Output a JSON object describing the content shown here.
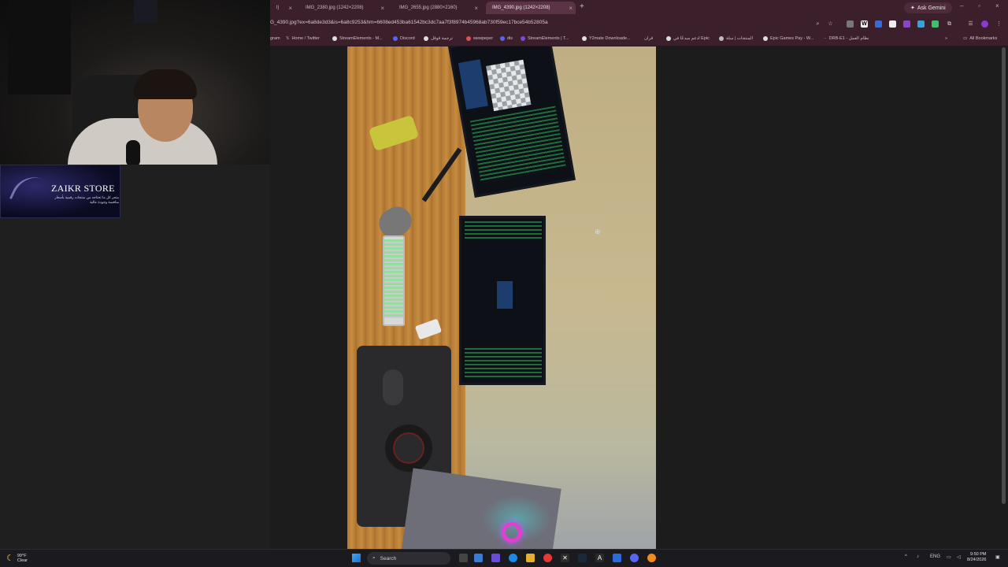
{
  "browser": {
    "tabs": [
      {
        "label": "IMG_2380.jpg (1242×2208)",
        "active": false
      },
      {
        "label": "IMG_2655.jpg (2880×2160)",
        "active": false
      },
      {
        "label": "IMG_4390.jpg (1242×2208)",
        "active": true
      }
    ],
    "partial_tab": "l)",
    "new_tab": "+",
    "gemini_label": "Ask Gemini",
    "url": "G_4390.jpg?ex=6a8de3d3&is=6a8c9253&hm=6608ed453ba61542bc3dc7aa7f3f8974b45968ab730f59ec17bce54b52805a",
    "bookmarks": [
      {
        "label": "gram"
      },
      {
        "label": "Home / Twitter"
      },
      {
        "label": "StreamElements - M..."
      },
      {
        "label": "Discord"
      },
      {
        "label": "ترجمة قوقل"
      },
      {
        "label": "wewpeper"
      },
      {
        "label": "dis"
      },
      {
        "label": "StreamElements | T..."
      },
      {
        "label": "Y2mate Downloade..."
      },
      {
        "label": "قران"
      },
      {
        "label": "ادعم مبدعًا في Epic"
      },
      {
        "label": "المنتجات | سلة"
      },
      {
        "label": "Epic Games Pay - W..."
      },
      {
        "label": "DRB-E1 - نظام العمل"
      }
    ],
    "all_bookmarks": "All Bookmarks",
    "overflow": "»"
  },
  "overlay": {
    "store_title": "ZAIKR STORE",
    "store_sub": "متجر كل ما تحتاجه من منتجات رقمية بأسعار منافسة وجودة عالية"
  },
  "taskbar": {
    "weather_temp": "99°F",
    "weather_desc": "Clear",
    "search_placeholder": "Search",
    "lang": "ENG",
    "time": "9:50 PM",
    "date": "8/24/2026"
  },
  "colors": {
    "chrome": "#3b1f2b",
    "active_tab": "#5a3344",
    "taskbar": "#1b1b1f"
  }
}
